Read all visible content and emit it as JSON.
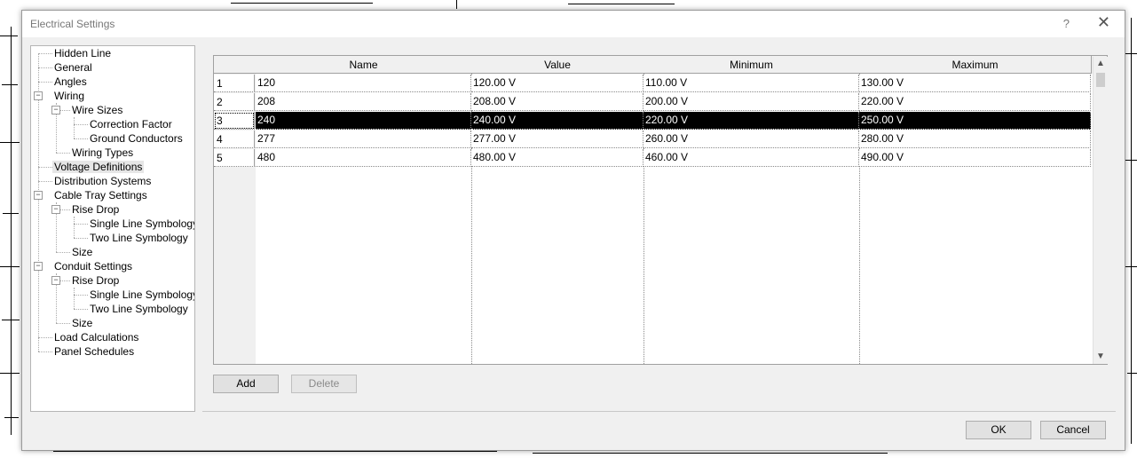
{
  "dialog": {
    "title": "Electrical Settings",
    "help_glyph": "?",
    "close_glyph": "✕"
  },
  "tree": {
    "items": [
      {
        "label": "Hidden Line"
      },
      {
        "label": "General"
      },
      {
        "label": "Angles"
      },
      {
        "label": "Wiring"
      },
      {
        "label": "Wire Sizes"
      },
      {
        "label": "Correction Factor"
      },
      {
        "label": "Ground Conductors"
      },
      {
        "label": "Wiring Types"
      },
      {
        "label": "Voltage Definitions"
      },
      {
        "label": "Distribution Systems"
      },
      {
        "label": "Cable Tray Settings"
      },
      {
        "label": "Rise Drop"
      },
      {
        "label": "Single Line Symbology"
      },
      {
        "label": "Two Line Symbology"
      },
      {
        "label": "Size"
      },
      {
        "label": "Conduit Settings"
      },
      {
        "label": "Rise Drop"
      },
      {
        "label": "Single Line Symbology"
      },
      {
        "label": "Two Line Symbology"
      },
      {
        "label": "Size"
      },
      {
        "label": "Load Calculations"
      },
      {
        "label": "Panel Schedules"
      }
    ],
    "selected": "Voltage Definitions",
    "expander_glyph": "−"
  },
  "table": {
    "columns": [
      "Name",
      "Value",
      "Minimum",
      "Maximum"
    ],
    "rows": [
      {
        "num": "1",
        "name": "120",
        "value": "120.00 V",
        "min": "110.00 V",
        "max": "130.00 V"
      },
      {
        "num": "2",
        "name": "208",
        "value": "208.00 V",
        "min": "200.00 V",
        "max": "220.00 V"
      },
      {
        "num": "3",
        "name": "240",
        "value": "240.00 V",
        "min": "220.00 V",
        "max": "250.00 V"
      },
      {
        "num": "4",
        "name": "277",
        "value": "277.00 V",
        "min": "260.00 V",
        "max": "280.00 V"
      },
      {
        "num": "5",
        "name": "480",
        "value": "480.00 V",
        "min": "460.00 V",
        "max": "490.00 V"
      }
    ],
    "selected_row": "3",
    "scroll_up_glyph": "▲",
    "scroll_down_glyph": "▼"
  },
  "buttons": {
    "add": "Add",
    "delete": "Delete",
    "ok": "OK",
    "cancel": "Cancel"
  }
}
